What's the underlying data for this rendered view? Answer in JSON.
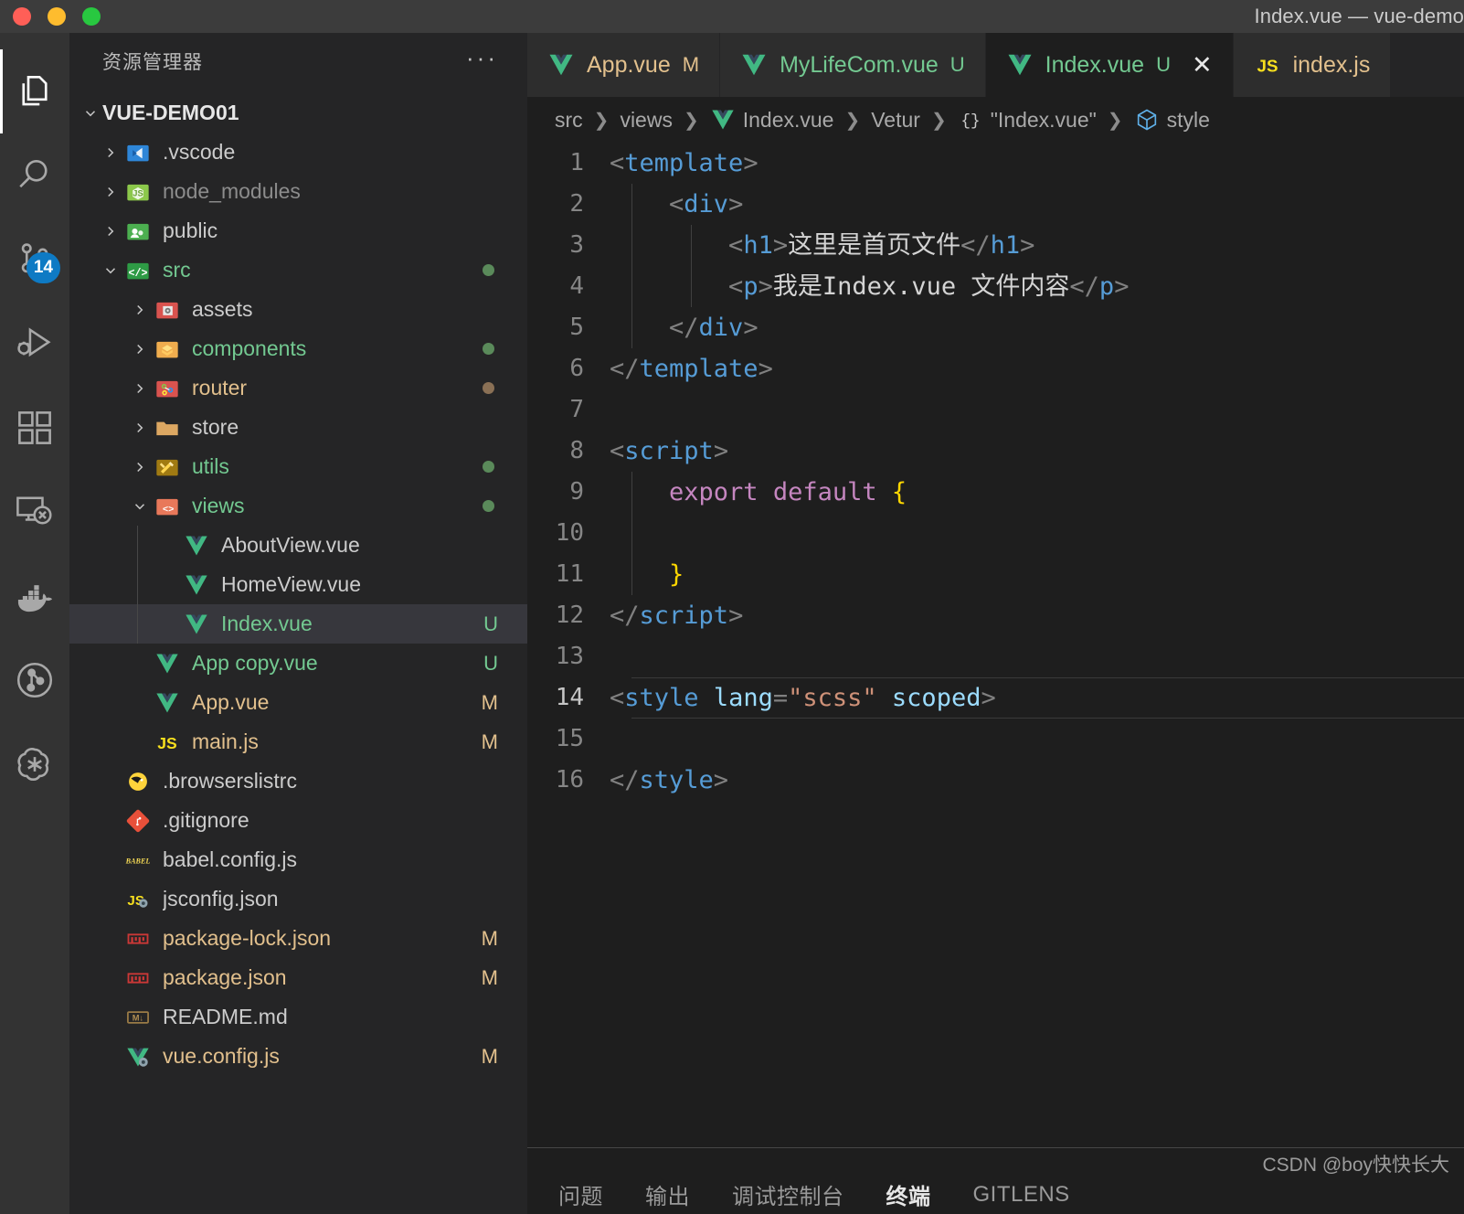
{
  "window": {
    "title": "Index.vue — vue-demo",
    "traffic_lights": [
      "close",
      "minimize",
      "maximize"
    ]
  },
  "activitybar": {
    "items": [
      {
        "name": "explorer",
        "icon": "files-icon",
        "active": true,
        "badge": null
      },
      {
        "name": "search",
        "icon": "search-icon",
        "active": false,
        "badge": null
      },
      {
        "name": "source-control",
        "icon": "source-control-icon",
        "active": false,
        "badge": "14"
      },
      {
        "name": "run-and-debug",
        "icon": "run-debug-icon",
        "active": false,
        "badge": null
      },
      {
        "name": "extensions",
        "icon": "extensions-icon",
        "active": false,
        "badge": null
      },
      {
        "name": "remote-explorer",
        "icon": "remote-explorer-icon",
        "active": false,
        "badge": null
      },
      {
        "name": "docker",
        "icon": "docker-icon",
        "active": false,
        "badge": null
      },
      {
        "name": "gitlens",
        "icon": "gitlens-icon",
        "active": false,
        "badge": null
      },
      {
        "name": "chatgpt",
        "icon": "openai-icon",
        "active": false,
        "badge": null
      }
    ]
  },
  "sidebar": {
    "header_title": "资源管理器",
    "more_actions": "···",
    "root": {
      "label": "VUE-DEMO01",
      "expanded": true
    },
    "tree": [
      {
        "label": ".vscode",
        "icon": "vscode-folder-icon",
        "kind": "folder",
        "expanded": false,
        "indent": 1,
        "color": "default",
        "status": "",
        "dot": ""
      },
      {
        "label": "node_modules",
        "icon": "node-folder-icon",
        "kind": "folder",
        "expanded": false,
        "indent": 1,
        "color": "dim",
        "status": "",
        "dot": ""
      },
      {
        "label": "public",
        "icon": "public-folder-icon",
        "kind": "folder",
        "expanded": false,
        "indent": 1,
        "color": "default",
        "status": "",
        "dot": ""
      },
      {
        "label": "src",
        "icon": "src-folder-icon",
        "kind": "folder",
        "expanded": true,
        "indent": 1,
        "color": "green",
        "status": "",
        "dot": "#5a8a5a"
      },
      {
        "label": "assets",
        "icon": "assets-folder-icon",
        "kind": "folder",
        "expanded": false,
        "indent": 2,
        "color": "default",
        "status": "",
        "dot": ""
      },
      {
        "label": "components",
        "icon": "components-folder-icon",
        "kind": "folder",
        "expanded": false,
        "indent": 2,
        "color": "green",
        "status": "",
        "dot": "#5a8a5a"
      },
      {
        "label": "router",
        "icon": "router-folder-icon",
        "kind": "folder",
        "expanded": false,
        "indent": 2,
        "color": "tan",
        "status": "",
        "dot": "#8a7055"
      },
      {
        "label": "store",
        "icon": "store-folder-icon",
        "kind": "folder",
        "expanded": false,
        "indent": 2,
        "color": "default",
        "status": "",
        "dot": ""
      },
      {
        "label": "utils",
        "icon": "utils-folder-icon",
        "kind": "folder",
        "expanded": false,
        "indent": 2,
        "color": "green",
        "status": "",
        "dot": "#5a8a5a"
      },
      {
        "label": "views",
        "icon": "views-folder-icon",
        "kind": "folder",
        "expanded": true,
        "indent": 2,
        "color": "green",
        "status": "",
        "dot": "#5a8a5a"
      },
      {
        "label": "AboutView.vue",
        "icon": "vue-file-icon",
        "kind": "file",
        "expanded": null,
        "indent": 3,
        "color": "default",
        "status": "",
        "dot": ""
      },
      {
        "label": "HomeView.vue",
        "icon": "vue-file-icon",
        "kind": "file",
        "expanded": null,
        "indent": 3,
        "color": "default",
        "status": "",
        "dot": ""
      },
      {
        "label": "Index.vue",
        "icon": "vue-file-icon",
        "kind": "file",
        "expanded": null,
        "indent": 3,
        "color": "green",
        "status": "U",
        "dot": "",
        "selected": true
      },
      {
        "label": "App copy.vue",
        "icon": "vue-file-icon",
        "kind": "file",
        "expanded": null,
        "indent": 2,
        "color": "green",
        "status": "U",
        "dot": ""
      },
      {
        "label": "App.vue",
        "icon": "vue-file-icon",
        "kind": "file",
        "expanded": null,
        "indent": 2,
        "color": "tan",
        "status": "M",
        "dot": ""
      },
      {
        "label": "main.js",
        "icon": "js-file-icon",
        "kind": "file",
        "expanded": null,
        "indent": 2,
        "color": "tan",
        "status": "M",
        "dot": ""
      },
      {
        "label": ".browserslistrc",
        "icon": "browserslist-icon",
        "kind": "file",
        "expanded": null,
        "indent": 1,
        "color": "default",
        "status": "",
        "dot": ""
      },
      {
        "label": ".gitignore",
        "icon": "git-icon",
        "kind": "file",
        "expanded": null,
        "indent": 1,
        "color": "default",
        "status": "",
        "dot": ""
      },
      {
        "label": "babel.config.js",
        "icon": "babel-icon",
        "kind": "file",
        "expanded": null,
        "indent": 1,
        "color": "default",
        "status": "",
        "dot": ""
      },
      {
        "label": "jsconfig.json",
        "icon": "jsconfig-icon",
        "kind": "file",
        "expanded": null,
        "indent": 1,
        "color": "default",
        "status": "",
        "dot": ""
      },
      {
        "label": "package-lock.json",
        "icon": "npm-icon",
        "kind": "file",
        "expanded": null,
        "indent": 1,
        "color": "tan",
        "status": "M",
        "dot": ""
      },
      {
        "label": "package.json",
        "icon": "npm-icon",
        "kind": "file",
        "expanded": null,
        "indent": 1,
        "color": "tan",
        "status": "M",
        "dot": ""
      },
      {
        "label": "README.md",
        "icon": "markdown-icon",
        "kind": "file",
        "expanded": null,
        "indent": 1,
        "color": "default",
        "status": "",
        "dot": ""
      },
      {
        "label": "vue.config.js",
        "icon": "vue-config-icon",
        "kind": "file",
        "expanded": null,
        "indent": 1,
        "color": "tan",
        "status": "M",
        "dot": ""
      }
    ]
  },
  "tabs": [
    {
      "label": "App.vue",
      "icon": "vue-file-icon",
      "status": "M",
      "color": "mod",
      "active": false,
      "closable": false
    },
    {
      "label": "MyLifeCom.vue",
      "icon": "vue-file-icon",
      "status": "U",
      "color": "untracked",
      "active": false,
      "closable": false
    },
    {
      "label": "Index.vue",
      "icon": "vue-file-icon",
      "status": "U",
      "color": "untracked",
      "active": true,
      "closable": true
    },
    {
      "label": "index.js",
      "icon": "js-file-icon",
      "status": "",
      "color": "mod",
      "active": false,
      "closable": false
    }
  ],
  "breadcrumb": [
    {
      "label": "src",
      "icon": ""
    },
    {
      "label": "views",
      "icon": ""
    },
    {
      "label": "Index.vue",
      "icon": "vue-file-icon"
    },
    {
      "label": "Vetur",
      "icon": ""
    },
    {
      "label": "\"Index.vue\"",
      "icon": "braces-icon"
    },
    {
      "label": "style",
      "icon": "symbol-namespace-icon"
    }
  ],
  "editor": {
    "current_line": 14,
    "lines": [
      {
        "n": 1,
        "guides": [],
        "tokens": [
          {
            "t": "<",
            "c": "punct"
          },
          {
            "t": "template",
            "c": "tag"
          },
          {
            "t": ">",
            "c": "punct"
          }
        ]
      },
      {
        "n": 2,
        "guides": [
          0
        ],
        "tokens": [
          {
            "t": "    ",
            "c": "txt"
          },
          {
            "t": "<",
            "c": "punct"
          },
          {
            "t": "div",
            "c": "tag"
          },
          {
            "t": ">",
            "c": "punct"
          }
        ]
      },
      {
        "n": 3,
        "guides": [
          0,
          1
        ],
        "tokens": [
          {
            "t": "        ",
            "c": "txt"
          },
          {
            "t": "<",
            "c": "punct"
          },
          {
            "t": "h1",
            "c": "tag"
          },
          {
            "t": ">",
            "c": "punct"
          },
          {
            "t": "这里是首页文件",
            "c": "txt"
          },
          {
            "t": "</",
            "c": "punct"
          },
          {
            "t": "h1",
            "c": "tag"
          },
          {
            "t": ">",
            "c": "punct"
          }
        ]
      },
      {
        "n": 4,
        "guides": [
          0,
          1
        ],
        "tokens": [
          {
            "t": "        ",
            "c": "txt"
          },
          {
            "t": "<",
            "c": "punct"
          },
          {
            "t": "p",
            "c": "tag"
          },
          {
            "t": ">",
            "c": "punct"
          },
          {
            "t": "我是Index.vue 文件内容",
            "c": "txt"
          },
          {
            "t": "</",
            "c": "punct"
          },
          {
            "t": "p",
            "c": "tag"
          },
          {
            "t": ">",
            "c": "punct"
          }
        ]
      },
      {
        "n": 5,
        "guides": [
          0
        ],
        "tokens": [
          {
            "t": "    ",
            "c": "txt"
          },
          {
            "t": "</",
            "c": "punct"
          },
          {
            "t": "div",
            "c": "tag"
          },
          {
            "t": ">",
            "c": "punct"
          }
        ]
      },
      {
        "n": 6,
        "guides": [],
        "tokens": [
          {
            "t": "</",
            "c": "punct"
          },
          {
            "t": "template",
            "c": "tag"
          },
          {
            "t": ">",
            "c": "punct"
          }
        ]
      },
      {
        "n": 7,
        "guides": [],
        "tokens": []
      },
      {
        "n": 8,
        "guides": [],
        "tokens": [
          {
            "t": "<",
            "c": "punct"
          },
          {
            "t": "script",
            "c": "tag"
          },
          {
            "t": ">",
            "c": "punct"
          }
        ]
      },
      {
        "n": 9,
        "guides": [
          0
        ],
        "tokens": [
          {
            "t": "    ",
            "c": "txt"
          },
          {
            "t": "export default",
            "c": "kw"
          },
          {
            "t": " ",
            "c": "txt"
          },
          {
            "t": "{",
            "c": "brace"
          }
        ]
      },
      {
        "n": 10,
        "guides": [
          0
        ],
        "tokens": []
      },
      {
        "n": 11,
        "guides": [
          0
        ],
        "tokens": [
          {
            "t": "    ",
            "c": "txt"
          },
          {
            "t": "}",
            "c": "brace"
          }
        ]
      },
      {
        "n": 12,
        "guides": [],
        "tokens": [
          {
            "t": "</",
            "c": "punct"
          },
          {
            "t": "script",
            "c": "tag"
          },
          {
            "t": ">",
            "c": "punct"
          }
        ]
      },
      {
        "n": 13,
        "guides": [],
        "tokens": []
      },
      {
        "n": 14,
        "guides": [],
        "tokens": [
          {
            "t": "<",
            "c": "punct"
          },
          {
            "t": "style",
            "c": "tag"
          },
          {
            "t": " ",
            "c": "txt"
          },
          {
            "t": "lang",
            "c": "attr"
          },
          {
            "t": "=",
            "c": "punct"
          },
          {
            "t": "\"scss\"",
            "c": "str"
          },
          {
            "t": " ",
            "c": "txt"
          },
          {
            "t": "scoped",
            "c": "attr"
          },
          {
            "t": ">",
            "c": "punct"
          }
        ]
      },
      {
        "n": 15,
        "guides": [],
        "tokens": []
      },
      {
        "n": 16,
        "guides": [],
        "tokens": [
          {
            "t": "</",
            "c": "punct"
          },
          {
            "t": "style",
            "c": "tag"
          },
          {
            "t": ">",
            "c": "punct"
          }
        ]
      }
    ]
  },
  "panel": {
    "tabs": [
      {
        "label": "问题",
        "active": false
      },
      {
        "label": "输出",
        "active": false
      },
      {
        "label": "调试控制台",
        "active": false
      },
      {
        "label": "终端",
        "active": true
      },
      {
        "label": "GITLENS",
        "active": false
      }
    ],
    "watermark": "CSDN @boy快快长大"
  },
  "colors": {
    "accent_blue": "#0e7ac4",
    "editor_bg": "#1e1e1e",
    "sidebar_bg": "#252526",
    "activitybar_bg": "#333333",
    "titlebar_bg": "#3c3c3c",
    "selected_row": "#37373d",
    "modified_tan": "#e2c08d",
    "untracked_green": "#73c991"
  }
}
